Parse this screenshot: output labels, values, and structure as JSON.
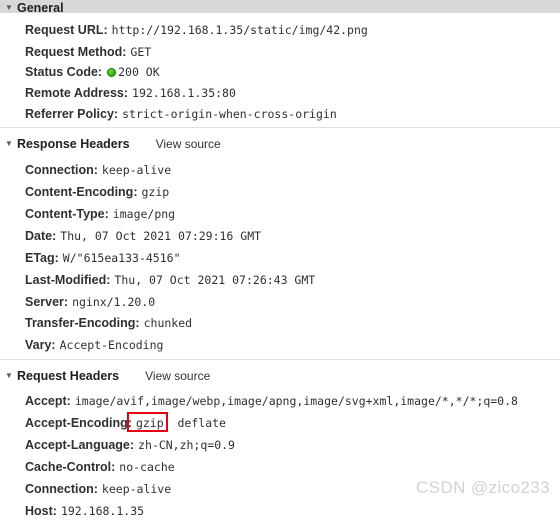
{
  "panel": {
    "twisty_glyph": "▼",
    "view_source_label": "View source"
  },
  "watermark": "CSDN @zico233",
  "sections": [
    {
      "id": "general",
      "title": "General",
      "has_view_source": false,
      "rows": [
        {
          "key": "Request URL:",
          "value": "http://192.168.1.35/static/img/42.png"
        },
        {
          "key": "Request Method:",
          "value": "GET"
        },
        {
          "key": "Status Code:",
          "value": "200 OK",
          "status_dot": true,
          "status_color": "#34b71a"
        },
        {
          "key": "Remote Address:",
          "value": "192.168.1.35:80"
        },
        {
          "key": "Referrer Policy:",
          "value": "strict-origin-when-cross-origin"
        }
      ]
    },
    {
      "id": "response-headers",
      "title": "Response Headers",
      "has_view_source": true,
      "rows": [
        {
          "key": "Connection:",
          "value": "keep-alive"
        },
        {
          "key": "Content-Encoding:",
          "value": "gzip"
        },
        {
          "key": "Content-Type:",
          "value": "image/png"
        },
        {
          "key": "Date:",
          "value": "Thu, 07 Oct 2021 07:29:16 GMT"
        },
        {
          "key": "ETag:",
          "value": "W/\"615ea133-4516\""
        },
        {
          "key": "Last-Modified:",
          "value": "Thu, 07 Oct 2021 07:26:43 GMT"
        },
        {
          "key": "Server:",
          "value": "nginx/1.20.0"
        },
        {
          "key": "Transfer-Encoding:",
          "value": "chunked"
        },
        {
          "key": "Vary:",
          "value": "Accept-Encoding"
        }
      ]
    },
    {
      "id": "request-headers",
      "title": "Request Headers",
      "has_view_source": true,
      "rows": [
        {
          "key": "Accept:",
          "value": "image/avif,image/webp,image/apng,image/svg+xml,image/*,*/*;q=0.8"
        },
        {
          "key": "Accept-Encoding:",
          "value": "gzip, deflate",
          "highlight": "gzip,"
        },
        {
          "key": "Accept-Language:",
          "value": "zh-CN,zh;q=0.9"
        },
        {
          "key": "Cache-Control:",
          "value": "no-cache"
        },
        {
          "key": "Connection:",
          "value": "keep-alive"
        },
        {
          "key": "Host:",
          "value": "192.168.1.35"
        }
      ]
    }
  ],
  "annotation": {
    "highlight_color": "#e60012",
    "highlight_target": "gzip,"
  }
}
